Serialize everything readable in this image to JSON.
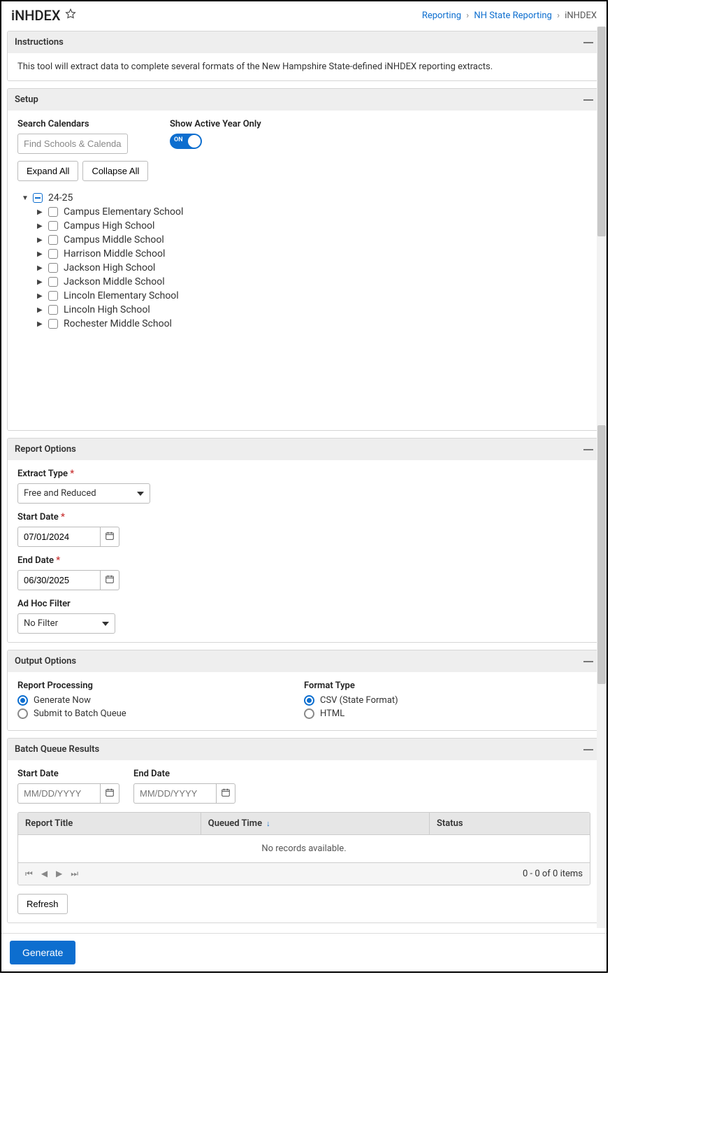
{
  "header": {
    "title": "iNHDEX",
    "breadcrumbs": [
      "Reporting",
      "NH State Reporting",
      "iNHDEX"
    ]
  },
  "instructions": {
    "title": "Instructions",
    "body": "This tool will extract data to complete several formats of the New Hampshire State-defined iNHDEX reporting extracts."
  },
  "setup": {
    "title": "Setup",
    "search_label": "Search Calendars",
    "search_placeholder": "Find Schools & Calendars",
    "active_year_label": "Show Active Year Only",
    "toggle_text": "ON",
    "expand_all": "Expand All",
    "collapse_all": "Collapse All",
    "tree": {
      "root": "24-25",
      "schools": [
        "Campus Elementary School",
        "Campus High School",
        "Campus Middle School",
        "Harrison Middle School",
        "Jackson High School",
        "Jackson Middle School",
        "Lincoln Elementary School",
        "Lincoln High School",
        "Rochester Middle School"
      ]
    }
  },
  "report_options": {
    "title": "Report Options",
    "extract_type_label": "Extract Type",
    "extract_type_value": "Free and Reduced",
    "start_date_label": "Start Date",
    "start_date_value": "07/01/2024",
    "end_date_label": "End Date",
    "end_date_value": "06/30/2025",
    "adhoc_label": "Ad Hoc Filter",
    "adhoc_value": "No Filter"
  },
  "output": {
    "title": "Output Options",
    "processing_label": "Report Processing",
    "processing_options": [
      "Generate Now",
      "Submit to Batch Queue"
    ],
    "format_label": "Format Type",
    "format_options": [
      "CSV  (State Format)",
      "HTML"
    ]
  },
  "batch": {
    "title": "Batch Queue Results",
    "start_date_label": "Start Date",
    "end_date_label": "End Date",
    "date_placeholder": "MM/DD/YYYY",
    "columns": [
      "Report Title",
      "Queued Time",
      "Status"
    ],
    "empty_text": "No records available.",
    "pager_text": "0 - 0 of 0 items",
    "refresh": "Refresh"
  },
  "footer": {
    "generate": "Generate"
  }
}
